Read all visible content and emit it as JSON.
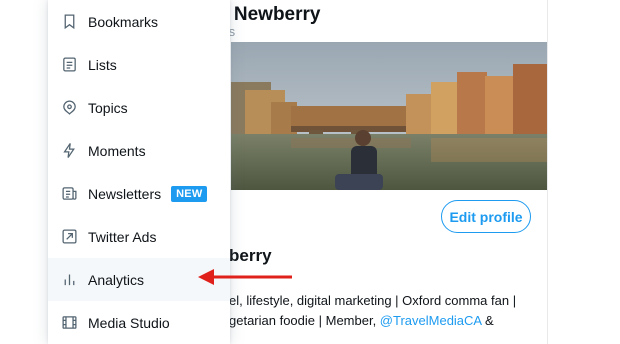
{
  "menu": {
    "items": [
      {
        "label": "Bookmarks",
        "icon": "bookmark-icon"
      },
      {
        "label": "Lists",
        "icon": "list-icon"
      },
      {
        "label": "Topics",
        "icon": "topic-icon"
      },
      {
        "label": "Moments",
        "icon": "lightning-icon"
      },
      {
        "label": "Newsletters",
        "icon": "newsletter-icon",
        "badge": "NEW"
      },
      {
        "label": "Twitter Ads",
        "icon": "ads-arrow-icon"
      },
      {
        "label": "Analytics",
        "icon": "analytics-icon",
        "highlighted": true
      },
      {
        "label": "Media Studio",
        "icon": "media-studio-icon"
      }
    ]
  },
  "profile": {
    "name_partial": "n Newberry",
    "subtitle_partial": "ts",
    "edit_button": "Edit profile",
    "display_name_partial": "berry",
    "bio_line1": "el, lifestyle, digital marketing | Oxford comma fan |",
    "bio_line2_start": "getarian foodie | Member, ",
    "bio_mention": "@TravelMediaCA",
    "bio_line2_end": " &"
  },
  "colors": {
    "accent": "#1d9bf0",
    "annotation_arrow": "#e0201b",
    "active_item_bg": "#f5f8fa"
  }
}
